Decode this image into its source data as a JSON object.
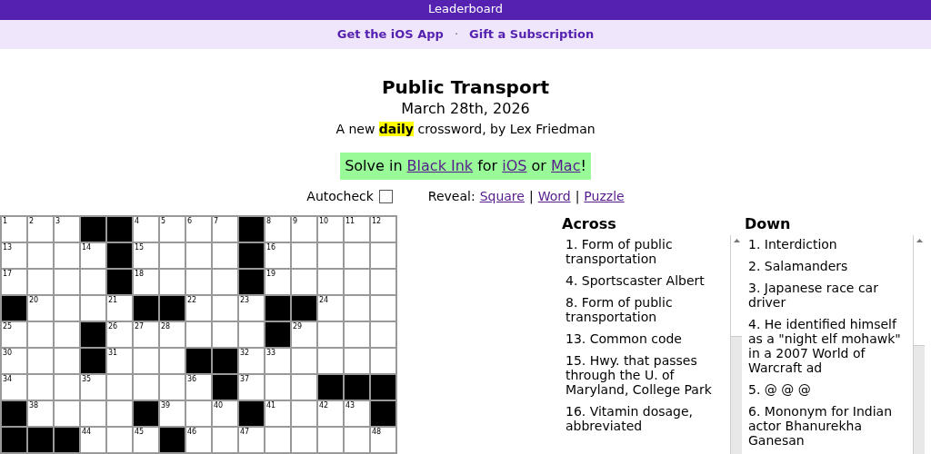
{
  "top_bar": {
    "label": "Leaderboard"
  },
  "sub_nav": {
    "links": [
      "Get the iOS App",
      "Gift a Subscription"
    ],
    "separator": "·"
  },
  "puzzle": {
    "title": "Public Transport",
    "date": "March 28th, 2026",
    "byline": "A new **daily** crossword, by Lex Friedman"
  },
  "promo": {
    "parts": [
      {
        "kind": "text",
        "text": "Solve in "
      },
      {
        "kind": "link",
        "text": "Black Ink"
      },
      {
        "kind": "text",
        "text": " for "
      },
      {
        "kind": "link",
        "text": "iOS"
      },
      {
        "kind": "text",
        "text": " or "
      },
      {
        "kind": "link",
        "text": "Mac"
      },
      {
        "kind": "text",
        "text": "!"
      }
    ]
  },
  "controls": {
    "autocheck": {
      "label": "Autocheck",
      "checked": false
    },
    "reveal_label": "Reveal:",
    "reveal_links": [
      "Square",
      "Word",
      "Puzzle"
    ],
    "separator": "|"
  },
  "grid": {
    "rows": [
      [
        {
          "kind": "open",
          "number": "1"
        },
        {
          "kind": "open",
          "number": "2"
        },
        {
          "kind": "open",
          "number": "3"
        },
        {
          "kind": "block"
        },
        {
          "kind": "block"
        },
        {
          "kind": "open",
          "number": "4"
        },
        {
          "kind": "open",
          "number": "5"
        },
        {
          "kind": "open",
          "number": "6"
        },
        {
          "kind": "open",
          "number": "7"
        },
        {
          "kind": "block"
        },
        {
          "kind": "open",
          "number": "8"
        },
        {
          "kind": "open",
          "number": "9"
        },
        {
          "kind": "open",
          "number": "10"
        },
        {
          "kind": "open",
          "number": "11"
        },
        {
          "kind": "open",
          "number": "12"
        }
      ],
      [
        {
          "kind": "open",
          "number": "13"
        },
        {
          "kind": "open"
        },
        {
          "kind": "open"
        },
        {
          "kind": "open",
          "number": "14"
        },
        {
          "kind": "block"
        },
        {
          "kind": "open",
          "number": "15"
        },
        {
          "kind": "open"
        },
        {
          "kind": "open"
        },
        {
          "kind": "open"
        },
        {
          "kind": "block"
        },
        {
          "kind": "open",
          "number": "16"
        },
        {
          "kind": "open"
        },
        {
          "kind": "open"
        },
        {
          "kind": "open"
        },
        {
          "kind": "open"
        }
      ],
      [
        {
          "kind": "open",
          "number": "17"
        },
        {
          "kind": "open"
        },
        {
          "kind": "open"
        },
        {
          "kind": "open"
        },
        {
          "kind": "block"
        },
        {
          "kind": "open",
          "number": "18"
        },
        {
          "kind": "open"
        },
        {
          "kind": "open"
        },
        {
          "kind": "open"
        },
        {
          "kind": "block"
        },
        {
          "kind": "open",
          "number": "19"
        },
        {
          "kind": "open"
        },
        {
          "kind": "open"
        },
        {
          "kind": "open"
        },
        {
          "kind": "open"
        }
      ],
      [
        {
          "kind": "block"
        },
        {
          "kind": "open",
          "number": "20"
        },
        {
          "kind": "open"
        },
        {
          "kind": "open"
        },
        {
          "kind": "open",
          "number": "21"
        },
        {
          "kind": "block"
        },
        {
          "kind": "block"
        },
        {
          "kind": "open",
          "number": "22"
        },
        {
          "kind": "open"
        },
        {
          "kind": "open",
          "number": "23"
        },
        {
          "kind": "block"
        },
        {
          "kind": "block"
        },
        {
          "kind": "open",
          "number": "24"
        },
        {
          "kind": "open"
        },
        {
          "kind": "open"
        }
      ],
      [
        {
          "kind": "open",
          "number": "25"
        },
        {
          "kind": "open"
        },
        {
          "kind": "open"
        },
        {
          "kind": "block"
        },
        {
          "kind": "open",
          "number": "26"
        },
        {
          "kind": "open",
          "number": "27"
        },
        {
          "kind": "open",
          "number": "28"
        },
        {
          "kind": "open"
        },
        {
          "kind": "open"
        },
        {
          "kind": "open"
        },
        {
          "kind": "block"
        },
        {
          "kind": "open",
          "number": "29"
        },
        {
          "kind": "open"
        },
        {
          "kind": "open"
        },
        {
          "kind": "open"
        }
      ],
      [
        {
          "kind": "open",
          "number": "30"
        },
        {
          "kind": "open"
        },
        {
          "kind": "open"
        },
        {
          "kind": "block"
        },
        {
          "kind": "open",
          "number": "31"
        },
        {
          "kind": "open"
        },
        {
          "kind": "open"
        },
        {
          "kind": "block"
        },
        {
          "kind": "block"
        },
        {
          "kind": "open",
          "number": "32"
        },
        {
          "kind": "open",
          "number": "33"
        },
        {
          "kind": "open"
        },
        {
          "kind": "open"
        },
        {
          "kind": "open"
        },
        {
          "kind": "open"
        }
      ],
      [
        {
          "kind": "open",
          "number": "34"
        },
        {
          "kind": "open"
        },
        {
          "kind": "open"
        },
        {
          "kind": "open",
          "number": "35"
        },
        {
          "kind": "open"
        },
        {
          "kind": "open"
        },
        {
          "kind": "open"
        },
        {
          "kind": "open",
          "number": "36"
        },
        {
          "kind": "block"
        },
        {
          "kind": "open",
          "number": "37"
        },
        {
          "kind": "open"
        },
        {
          "kind": "open"
        },
        {
          "kind": "block"
        },
        {
          "kind": "block"
        },
        {
          "kind": "block"
        }
      ],
      [
        {
          "kind": "block"
        },
        {
          "kind": "open",
          "number": "38"
        },
        {
          "kind": "open"
        },
        {
          "kind": "open"
        },
        {
          "kind": "open"
        },
        {
          "kind": "block"
        },
        {
          "kind": "open",
          "number": "39"
        },
        {
          "kind": "open"
        },
        {
          "kind": "open",
          "number": "40"
        },
        {
          "kind": "block"
        },
        {
          "kind": "open",
          "number": "41"
        },
        {
          "kind": "open"
        },
        {
          "kind": "open",
          "number": "42"
        },
        {
          "kind": "open",
          "number": "43"
        },
        {
          "kind": "block"
        }
      ],
      [
        {
          "kind": "block"
        },
        {
          "kind": "block"
        },
        {
          "kind": "block"
        },
        {
          "kind": "open",
          "number": "44"
        },
        {
          "kind": "open"
        },
        {
          "kind": "open",
          "number": "45"
        },
        {
          "kind": "block"
        },
        {
          "kind": "open",
          "number": "46"
        },
        {
          "kind": "open"
        },
        {
          "kind": "open",
          "number": "47"
        },
        {
          "kind": "open"
        },
        {
          "kind": "open"
        },
        {
          "kind": "open"
        },
        {
          "kind": "open"
        },
        {
          "kind": "open",
          "number": "48"
        }
      ]
    ]
  },
  "clues": [
    {
      "heading": "Across",
      "items": [
        "1. Form of public transportation",
        "4. Sportscaster Albert",
        "8. Form of public transportation",
        "13. Common code",
        "15. Hwy. that passes through the U. of Maryland, College Park",
        "16. Vitamin dosage, abbreviated"
      ]
    },
    {
      "heading": "Down",
      "items": [
        "1. Interdiction",
        "2. Salamanders",
        "3. Japanese race car driver",
        "4. He identified himself as a \"night elf mohawk\" in a 2007 World of Warcraft ad",
        "5. @ @ @",
        "6. Mononym for Indian actor Bhanurekha Ganesan"
      ]
    }
  ]
}
